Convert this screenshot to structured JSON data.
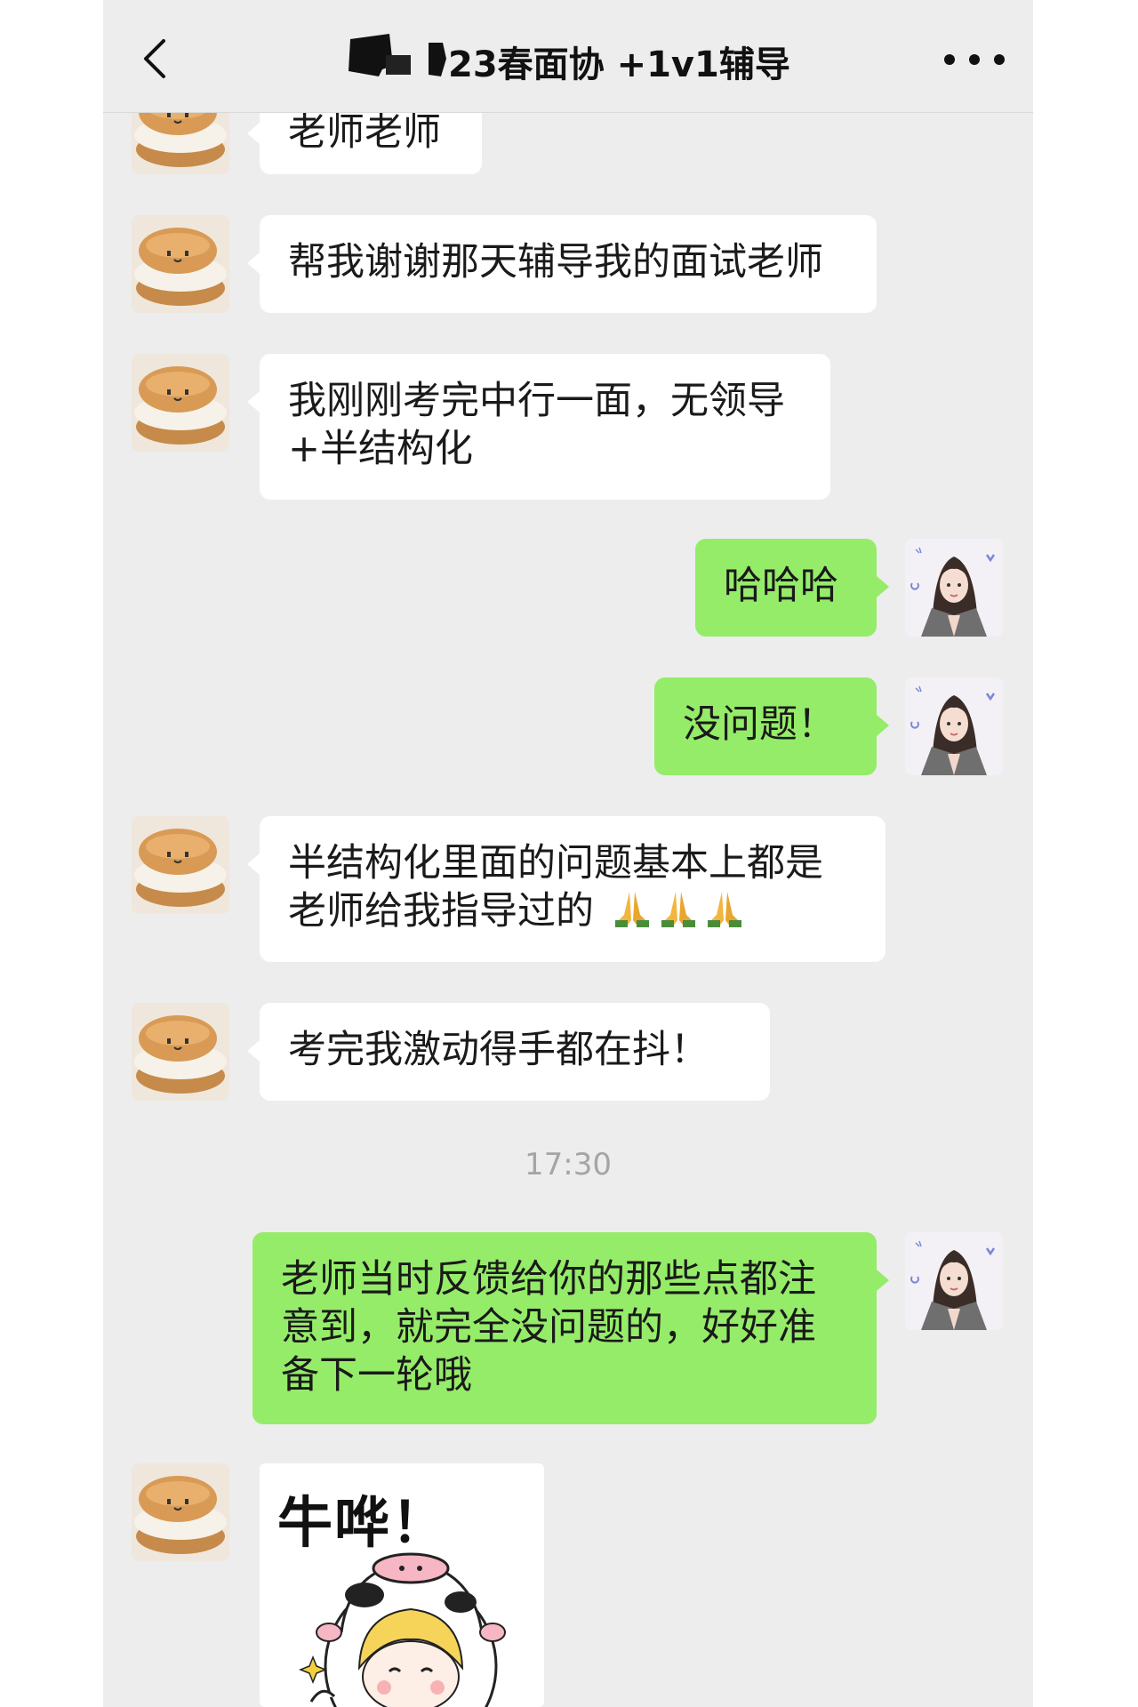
{
  "navbar": {
    "back_icon": "chevron-left-icon",
    "title": "23春面协 +1v1辅导",
    "more_icon": "ellipsis-icon"
  },
  "colors": {
    "background": "#ededed",
    "incoming_bubble": "#ffffff",
    "outgoing_bubble": "#95ec69"
  },
  "messages": [
    {
      "direction": "in",
      "text": "老师老师"
    },
    {
      "direction": "in",
      "text": "帮我谢谢那天辅导我的面试老师"
    },
    {
      "direction": "in",
      "line1": "我刚刚考完中行一面，无领导",
      "line2": "+半结构化"
    },
    {
      "direction": "out",
      "text": "哈哈哈"
    },
    {
      "direction": "out",
      "text": "没问题！"
    },
    {
      "direction": "in",
      "line1": "半结构化里面的问题基本上都是",
      "line2": "老师给我指导过的",
      "emoji": "folded-hands-icon x3"
    },
    {
      "direction": "in",
      "text": "考完我激动得手都在抖！"
    },
    {
      "direction": "out",
      "line1": "老师当时反馈给你的那些点都注",
      "line2": "意到，就完全没问题的，好好准",
      "line3": "备下一轮哦"
    },
    {
      "direction": "in",
      "sticker_text": "牛哗！",
      "sticker": "cow-costume-girl-sticker"
    }
  ],
  "timestamp": "17:30"
}
